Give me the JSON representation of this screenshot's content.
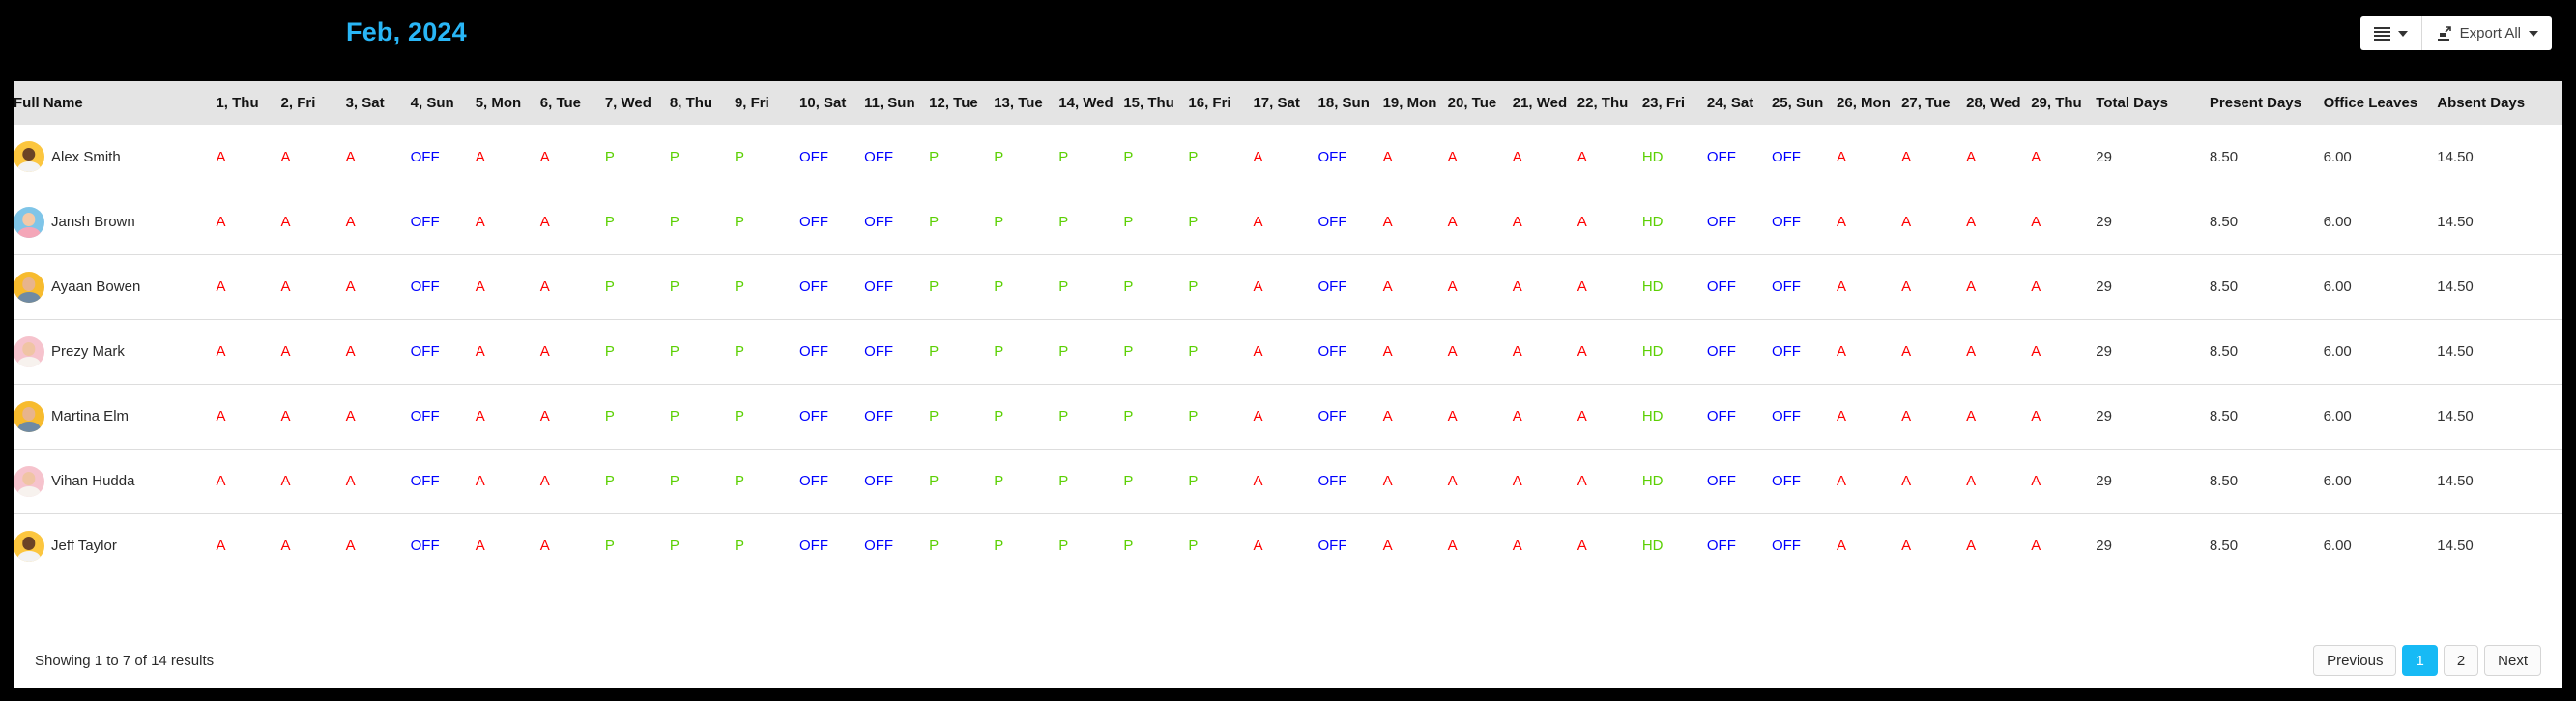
{
  "header": {
    "month_title": "Feb, 2024",
    "accent_color": "#29b6f6",
    "view_button_icon": "list-icon",
    "export_button_label": "Export All",
    "export_button_icon": "export-icon"
  },
  "table": {
    "name_column_header": "Full Name",
    "day_columns": [
      "1, Thu",
      "2, Fri",
      "3, Sat",
      "4, Sun",
      "5, Mon",
      "6, Tue",
      "7, Wed",
      "8, Thu",
      "9, Fri",
      "10, Sat",
      "11, Sun",
      "12, Tue",
      "13, Tue",
      "14, Wed",
      "15, Thu",
      "16, Fri",
      "17, Sat",
      "18, Sun",
      "19, Mon",
      "20, Tue",
      "21, Wed",
      "22, Thu",
      "23, Fri",
      "24, Sat",
      "25, Sun",
      "26, Mon",
      "27, Tue",
      "28, Wed",
      "29, Thu"
    ],
    "summary_columns": [
      "Total Days",
      "Present Days",
      "Office Leaves",
      "Absent Days"
    ],
    "marker_colors": {
      "A": "#ff0000",
      "P": "#5cd004",
      "HD": "#5cd004",
      "OFF": "#0000ff"
    },
    "rows": [
      {
        "name": "Alex Smith",
        "avatar": {
          "bg": "#fcc63f",
          "skin": "#6b4226",
          "shirt": "#f2f2f2"
        },
        "days": [
          "A",
          "A",
          "A",
          "OFF",
          "A",
          "A",
          "P",
          "P",
          "P",
          "OFF",
          "OFF",
          "P",
          "P",
          "P",
          "P",
          "P",
          "A",
          "OFF",
          "A",
          "A",
          "A",
          "A",
          "HD",
          "OFF",
          "OFF",
          "A",
          "A",
          "A",
          "A"
        ],
        "total_days": "29",
        "present_days": "8.50",
        "office_leaves": "6.00",
        "absent_days": "14.50"
      },
      {
        "name": "Jansh Brown",
        "avatar": {
          "bg": "#7fc5e8",
          "skin": "#f3c9a8",
          "shirt": "#f4a6b8"
        },
        "days": [
          "A",
          "A",
          "A",
          "OFF",
          "A",
          "A",
          "P",
          "P",
          "P",
          "OFF",
          "OFF",
          "P",
          "P",
          "P",
          "P",
          "P",
          "A",
          "OFF",
          "A",
          "A",
          "A",
          "A",
          "HD",
          "OFF",
          "OFF",
          "A",
          "A",
          "A",
          "A"
        ],
        "total_days": "29",
        "present_days": "8.50",
        "office_leaves": "6.00",
        "absent_days": "14.50"
      },
      {
        "name": "Ayaan Bowen",
        "avatar": {
          "bg": "#f7bb2e",
          "skin": "#e8b48d",
          "shirt": "#6f8aa3"
        },
        "days": [
          "A",
          "A",
          "A",
          "OFF",
          "A",
          "A",
          "P",
          "P",
          "P",
          "OFF",
          "OFF",
          "P",
          "P",
          "P",
          "P",
          "P",
          "A",
          "OFF",
          "A",
          "A",
          "A",
          "A",
          "HD",
          "OFF",
          "OFF",
          "A",
          "A",
          "A",
          "A"
        ],
        "total_days": "29",
        "present_days": "8.50",
        "office_leaves": "6.00",
        "absent_days": "14.50"
      },
      {
        "name": "Prezy Mark",
        "avatar": {
          "bg": "#f6c3cd",
          "skin": "#f0c4a4",
          "shirt": "#f7f2ee"
        },
        "days": [
          "A",
          "A",
          "A",
          "OFF",
          "A",
          "A",
          "P",
          "P",
          "P",
          "OFF",
          "OFF",
          "P",
          "P",
          "P",
          "P",
          "P",
          "A",
          "OFF",
          "A",
          "A",
          "A",
          "A",
          "HD",
          "OFF",
          "OFF",
          "A",
          "A",
          "A",
          "A"
        ],
        "total_days": "29",
        "present_days": "8.50",
        "office_leaves": "6.00",
        "absent_days": "14.50"
      },
      {
        "name": "Martina Elm",
        "avatar": {
          "bg": "#f7bb2e",
          "skin": "#e8b48d",
          "shirt": "#6f8aa3"
        },
        "days": [
          "A",
          "A",
          "A",
          "OFF",
          "A",
          "A",
          "P",
          "P",
          "P",
          "OFF",
          "OFF",
          "P",
          "P",
          "P",
          "P",
          "P",
          "A",
          "OFF",
          "A",
          "A",
          "A",
          "A",
          "HD",
          "OFF",
          "OFF",
          "A",
          "A",
          "A",
          "A"
        ],
        "total_days": "29",
        "present_days": "8.50",
        "office_leaves": "6.00",
        "absent_days": "14.50"
      },
      {
        "name": "Vihan Hudda",
        "avatar": {
          "bg": "#f6c3cd",
          "skin": "#f0c4a4",
          "shirt": "#f7f2ee"
        },
        "days": [
          "A",
          "A",
          "A",
          "OFF",
          "A",
          "A",
          "P",
          "P",
          "P",
          "OFF",
          "OFF",
          "P",
          "P",
          "P",
          "P",
          "P",
          "A",
          "OFF",
          "A",
          "A",
          "A",
          "A",
          "HD",
          "OFF",
          "OFF",
          "A",
          "A",
          "A",
          "A"
        ],
        "total_days": "29",
        "present_days": "8.50",
        "office_leaves": "6.00",
        "absent_days": "14.50"
      },
      {
        "name": "Jeff Taylor",
        "avatar": {
          "bg": "#fcc63f",
          "skin": "#6b4226",
          "shirt": "#f2f2f2"
        },
        "days": [
          "A",
          "A",
          "A",
          "OFF",
          "A",
          "A",
          "P",
          "P",
          "P",
          "OFF",
          "OFF",
          "P",
          "P",
          "P",
          "P",
          "P",
          "A",
          "OFF",
          "A",
          "A",
          "A",
          "A",
          "HD",
          "OFF",
          "OFF",
          "A",
          "A",
          "A",
          "A"
        ],
        "total_days": "29",
        "present_days": "8.50",
        "office_leaves": "6.00",
        "absent_days": "14.50"
      }
    ]
  },
  "footer": {
    "showing_text": "Showing 1 to 7 of 14 results",
    "previous_label": "Previous",
    "next_label": "Next",
    "pages": [
      "1",
      "2"
    ],
    "active_page": "1",
    "active_color": "#17baf5"
  }
}
